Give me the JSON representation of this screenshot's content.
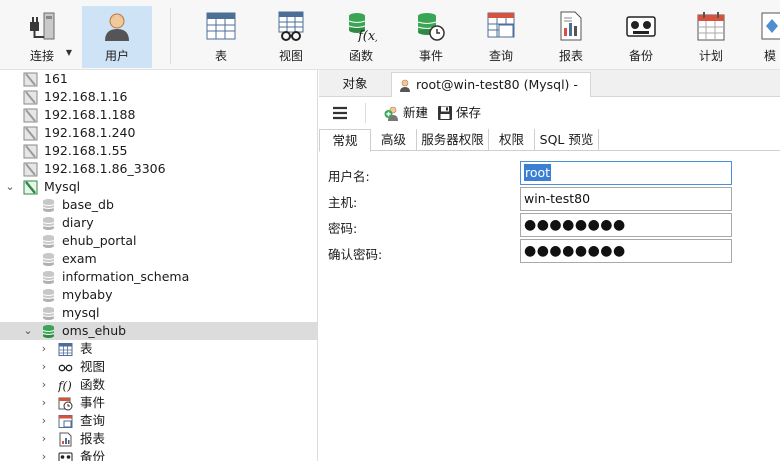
{
  "toolbar": {
    "items": [
      {
        "label": "连接",
        "icon": "connection-icon"
      },
      {
        "label": "用户",
        "icon": "user-icon",
        "active": true
      },
      {
        "label": "表",
        "icon": "table-icon"
      },
      {
        "label": "视图",
        "icon": "view-icon"
      },
      {
        "label": "函数",
        "icon": "function-icon"
      },
      {
        "label": "事件",
        "icon": "event-icon"
      },
      {
        "label": "查询",
        "icon": "query-icon"
      },
      {
        "label": "报表",
        "icon": "report-icon"
      },
      {
        "label": "备份",
        "icon": "backup-icon"
      },
      {
        "label": "计划",
        "icon": "schedule-icon"
      },
      {
        "label": "模",
        "icon": "model-icon"
      }
    ]
  },
  "tree": {
    "connections": [
      "161",
      "192.168.1.16",
      "192.168.1.188",
      "192.168.1.240",
      "192.168.1.55",
      "192.168.1.86_3306"
    ],
    "mysql_label": "Mysql",
    "databases": [
      "base_db",
      "diary",
      "ehub_portal",
      "exam",
      "information_schema",
      "mybaby",
      "mysql"
    ],
    "selected_db": "oms_ehub",
    "sub_items": [
      "表",
      "视图",
      "函数",
      "事件",
      "查询",
      "报表",
      "备份"
    ]
  },
  "tabs": {
    "objects": "对象",
    "active": "root@win-test80 (Mysql) - ..."
  },
  "actions": {
    "new": "新建",
    "save": "保存"
  },
  "form_tabs": [
    "常规",
    "高级",
    "服务器权限",
    "权限",
    "SQL 预览"
  ],
  "form": {
    "username_label": "用户名:",
    "username_value": "root",
    "host_label": "主机:",
    "host_value": "win-test80",
    "password_label": "密码:",
    "password_value": "●●●●●●●●",
    "confirm_label": "确认密码:",
    "confirm_value": "●●●●●●●●"
  },
  "colors": {
    "accent": "#3a7fd4",
    "active_tool": "#cfe3f6",
    "db_green": "#3aa655"
  }
}
